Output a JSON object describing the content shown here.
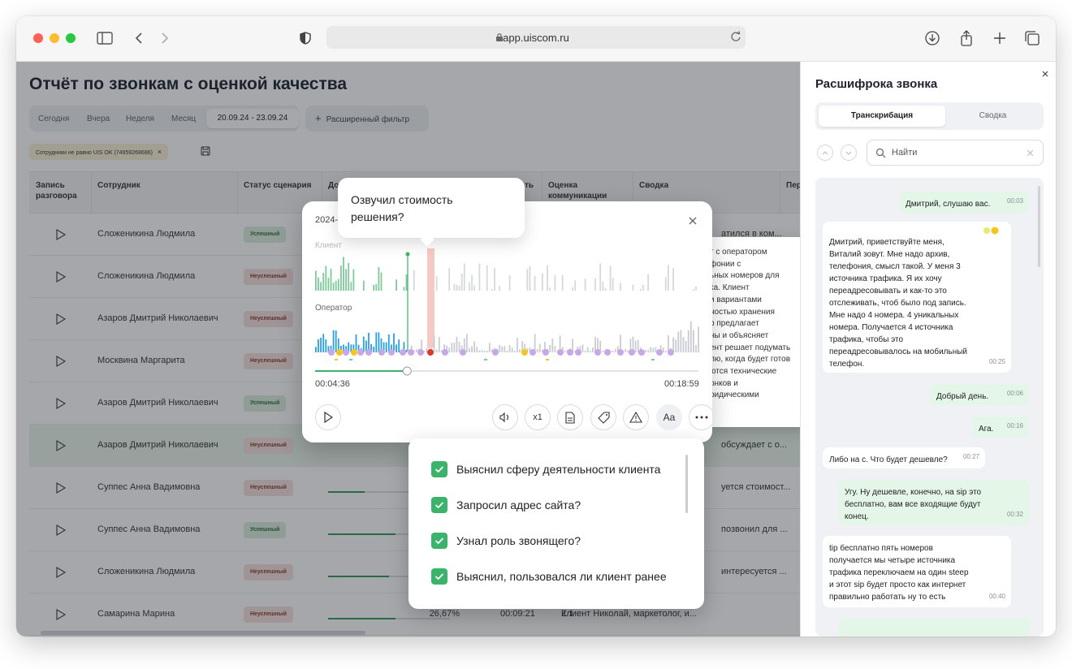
{
  "browser": {
    "url": "app.uiscom.ru"
  },
  "page": {
    "title": "Отчёт по звонкам с оценкой качества",
    "periods": [
      "Сегодня",
      "Вчера",
      "Неделя",
      "Месяц"
    ],
    "date_range": "20.09.24 - 23.09.24",
    "advanced_filter": "Расширенный фильтр",
    "filter_chip": "Сотрудники не равно UIS OK (74959268686)",
    "columns": [
      "Запись разговора",
      "Сотрудник",
      "Статус сценария",
      "До",
      "ть",
      "Оценка коммуникации",
      "Сводка",
      "Пер"
    ],
    "rows": [
      {
        "employee": "Сложеникина Людмила",
        "status": "Успешный",
        "summary": "атился в ком..."
      },
      {
        "employee": "Сложеникина Людмила",
        "status": "Неуспешный",
        "summary": ""
      },
      {
        "employee": "Азаров Дмитрий Николаевич",
        "status": "Неуспешный",
        "summary": ""
      },
      {
        "employee": "Москвина Маргарита",
        "status": "Неуспешный",
        "summary": ""
      },
      {
        "employee": "Азаров Дмитрий Николаевич",
        "status": "Успешный",
        "summary": ""
      },
      {
        "employee": "Азаров Дмитрий Николаевич",
        "status": "Неуспешный",
        "summary": "обсуждает с о..."
      },
      {
        "employee": "Суппес Анна Вадимовна",
        "status": "Неуспешный",
        "summary": "уется стоимост..."
      },
      {
        "employee": "Суппес Анна Вадимовна",
        "status": "Успешный",
        "summary": "позвонил для ..."
      },
      {
        "employee": "Сложеникина Людмила",
        "status": "Неуспешный",
        "summary": "интересуется ..."
      },
      {
        "employee": "Самарина Марина",
        "status": "Неуспешный",
        "percent": "26,67%",
        "duration": "00:09:21",
        "score": "2.1",
        "summary": "Клиент Николай, маркетолог, и..."
      }
    ]
  },
  "summary_popup": {
    "text": "т с оператором\nфонии с\nьных номеров для\nка. Клиент\nи вариантами\nностью хранения\nр предлагает\nны и объясняет\nент решает подумать\nлю, когда будет готов\nются технические\nонков и\nридическими"
  },
  "player": {
    "date": "2024-",
    "client_label": "Клиент",
    "operator_label": "Оператор",
    "current_time": "00:04:36",
    "total_time": "00:18:59",
    "progress": 0.24,
    "speed_label": "x1",
    "font_label": "Aa",
    "tooltip": "Озвучил стоимость\nрешения?"
  },
  "checklist": {
    "items": [
      {
        "label": "Выяснил сферу деятельности клиента",
        "checked": true
      },
      {
        "label": "Запросил адрес сайта?",
        "checked": true
      },
      {
        "label": "Узнал роль звонящего?",
        "checked": true
      },
      {
        "label": "Выяснил, пользовался ли клиент ранее",
        "checked": true
      }
    ]
  },
  "transcript": {
    "title": "Расшифрока звонка",
    "tab_transcription": "Транскрибация",
    "tab_summary": "Сводка",
    "search_placeholder": "Найти",
    "messages": [
      {
        "who": "operator",
        "text": "Дмитрий, слушаю вас.",
        "time": "00:03"
      },
      {
        "who": "client",
        "text": "Дмитрий, приветствуйте меня,\nВиталий зовут. Мне надо архив,\nтелефония, смысл такой. У меня 3\nисточника трафика. Я их хочу\nпереадресовывать и как-то это\nотслеживать, чтоб было под запись.\nМне надо 4 номера. 4 уникальных\nномера. Получается 4 источника\nтрафика, чтобы это\nпереадресовывалось на мобильный\nтелефон.",
        "time": "00:25"
      },
      {
        "who": "operator",
        "text": "Добрый день.",
        "time": "00:06"
      },
      {
        "who": "operator",
        "text": "Ага.",
        "time": "00:16"
      },
      {
        "who": "client",
        "text": "Либо на с. Что будет дешевле?",
        "time": "00:27"
      },
      {
        "who": "operator",
        "text": "Угу. Ну дешевле, конечно, на sip это\nбесплатно, вам все входящие будут\nконец.",
        "time": "00:32"
      },
      {
        "who": "client",
        "text": "tip бесплатно пять номеров\nполучается мы четыре источника\nтрафика переключаем на один steep\nи этот sip будет просто как интернет\nправильно работать ну то есть",
        "time": "00:40"
      }
    ]
  },
  "colors": {
    "accent_green": "#3bb36a",
    "operator_wave": "#2b9fe0",
    "client_wave": "#7fc99a",
    "marker": "#d93b2f"
  }
}
